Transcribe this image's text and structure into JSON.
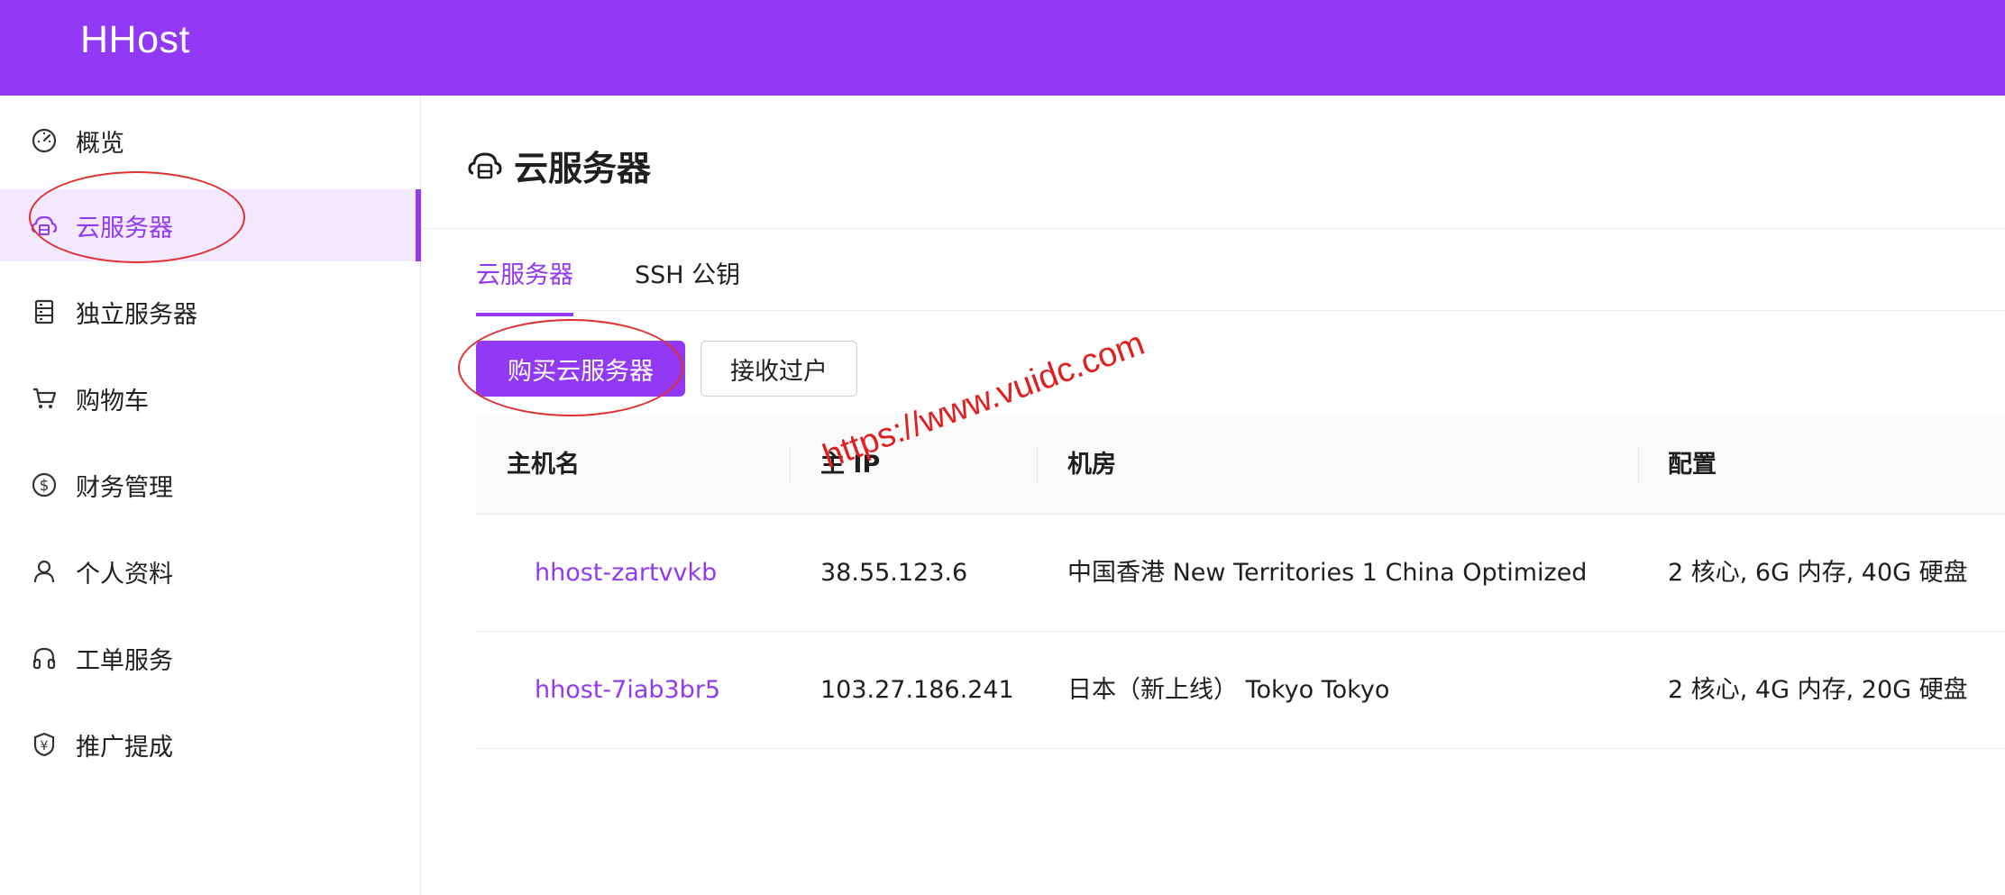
{
  "app": {
    "logo": "HHost"
  },
  "sidebar": {
    "items": [
      {
        "label": "概览",
        "icon": "dashboard-icon"
      },
      {
        "label": "云服务器",
        "icon": "cloud-server-icon",
        "active": true
      },
      {
        "label": "独立服务器",
        "icon": "server-rack-icon"
      },
      {
        "label": "购物车",
        "icon": "cart-icon"
      },
      {
        "label": "财务管理",
        "icon": "dollar-circle-icon"
      },
      {
        "label": "个人资料",
        "icon": "user-icon"
      },
      {
        "label": "工单服务",
        "icon": "headset-icon"
      },
      {
        "label": "推广提成",
        "icon": "yen-badge-icon"
      }
    ]
  },
  "main": {
    "title": "云服务器",
    "tabs": [
      {
        "label": "云服务器",
        "active": true
      },
      {
        "label": "SSH 公钥",
        "active": false
      }
    ],
    "buttons": {
      "buy": "购买云服务器",
      "transfer": "接收过户"
    },
    "table": {
      "columns": [
        "主机名",
        "主 IP",
        "机房",
        "配置"
      ],
      "rows": [
        {
          "hostname": "hhost-zartvvkb",
          "ip": "38.55.123.6",
          "location": "中国香港 New Territories 1 China Optimized",
          "config": "2 核心, 6G 内存, 40G 硬盘"
        },
        {
          "hostname": "hhost-7iab3br5",
          "ip": "103.27.186.241",
          "location": "日本（新上线） Tokyo Tokyo",
          "config": "2 核心, 4G 内存, 20G 硬盘"
        }
      ]
    }
  },
  "watermark": "https://www.vuidc.com",
  "colors": {
    "brand": "#9139f5",
    "active_bg": "#f4e8fe",
    "annotation": "#e02020"
  }
}
